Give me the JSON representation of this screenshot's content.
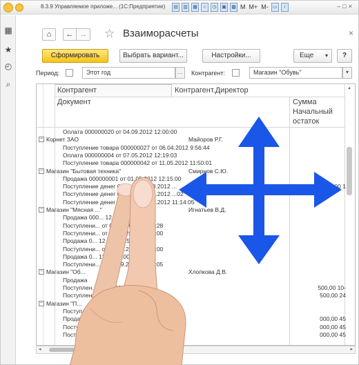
{
  "titlebar": {
    "title": "8.3.9 Управляемое приложе... (1С:Предприятие)",
    "m": "M",
    "mplus": "M+",
    "mminus": "M-"
  },
  "page": {
    "title": "Взаиморасчеты"
  },
  "toolbar": {
    "generate": "Сформировать",
    "choose_variant": "Выбрать вариант...",
    "settings": "Настройки...",
    "more": "Еще",
    "help": "?"
  },
  "filters": {
    "period_label": "Период:",
    "period_value": "Этот год",
    "counterparty_label": "Контрагент:",
    "counterparty_value": "Магазин \"Обувь\""
  },
  "report": {
    "headers": {
      "counterparty": "Контрагент",
      "director": "Контрагент.Директор",
      "document": "Документ",
      "sum": "Сумма",
      "opening": "Начальный",
      "balance": "остаток"
    },
    "rows": [
      {
        "type": "doc",
        "text": "Оплата 000000020 от 04.09.2012 12:00:00",
        "sum": ""
      },
      {
        "type": "group",
        "text": "Корнет ЗАО",
        "director": "Майоров Р.Г.",
        "sum": ""
      },
      {
        "type": "doc",
        "text": "Поступление товара 000000027 от 06.04.2012 9:56:44",
        "sum": ""
      },
      {
        "type": "doc",
        "text": "Оплата 000000004 от 07.05.2012 12:19:03",
        "sum": ""
      },
      {
        "type": "doc",
        "text": "Поступление товара 000000042 от 11.05.2012 11:50:01",
        "sum": ""
      },
      {
        "type": "group",
        "text": "Магазин \"Бытовая техника\"",
        "director": "Смирнов С.Ю.",
        "sum": ""
      },
      {
        "type": "doc",
        "text": "Продажа 000000001 от 01.05.2012 12:15:00",
        "sum": ""
      },
      {
        "type": "doc",
        "text": "Поступление денег 000... от 05.08.2012 ...",
        "sum": "1 000,00"
      },
      {
        "type": "doc",
        "text": "Поступление денег 000... от 03.09.2012 ...02",
        "sum": ""
      },
      {
        "type": "doc",
        "text": "Поступление денег 000... от 05.09.2012 11:14:05",
        "sum": ""
      },
      {
        "type": "group",
        "text": "Магазин \"Мясная ...\"",
        "director": "Игнатьев В.Д.",
        "sum": ""
      },
      {
        "type": "doc",
        "text": "Продажа 000... 12 16:14:00",
        "sum": ""
      },
      {
        "type": "doc",
        "text": "Поступлени... от 05.08.2012 15:35:28",
        "sum": ""
      },
      {
        "type": "doc",
        "text": "Поступлени... от 28.08.2012 12:00:00",
        "sum": ""
      },
      {
        "type": "doc",
        "text": "Продажа 0... 12 10:20:25",
        "sum": ""
      },
      {
        "type": "doc",
        "text": "Поступлени... от 04.09.2012 10:30:00",
        "sum": ""
      },
      {
        "type": "doc",
        "text": "Продажа 0... 12 12:05:00",
        "sum": ""
      },
      {
        "type": "doc",
        "text": "Поступлени... от 05.09.2012 12:10:05",
        "sum": ""
      },
      {
        "type": "group",
        "text": "Магазин \"Об...",
        "director": "Хлопкова Д.В.",
        "sum": ""
      },
      {
        "type": "doc",
        "text": "Продажа",
        "sum": ""
      },
      {
        "type": "doc",
        "text": "Поступлен... 19:18:02",
        "sum": "-10 500,00"
      },
      {
        "type": "doc",
        "text": "Поступлен... 14:06:20",
        "sum": "24 500,00"
      },
      {
        "type": "group",
        "text": "Магазин \"П...",
        "director": "",
        "sum": ""
      },
      {
        "type": "doc",
        "text": "Поступлен...",
        "sum": ""
      },
      {
        "type": "doc",
        "text": "Продаж...",
        "sum": "45 000,00"
      },
      {
        "type": "doc",
        "text": "Поступ...",
        "sum": "45 000,00"
      },
      {
        "type": "doc",
        "text": "Поступ...",
        "sum": "45 000,00"
      }
    ]
  },
  "overlay": {
    "gesture": "two-finger-pan",
    "arrow_color": "#1a56e8"
  }
}
